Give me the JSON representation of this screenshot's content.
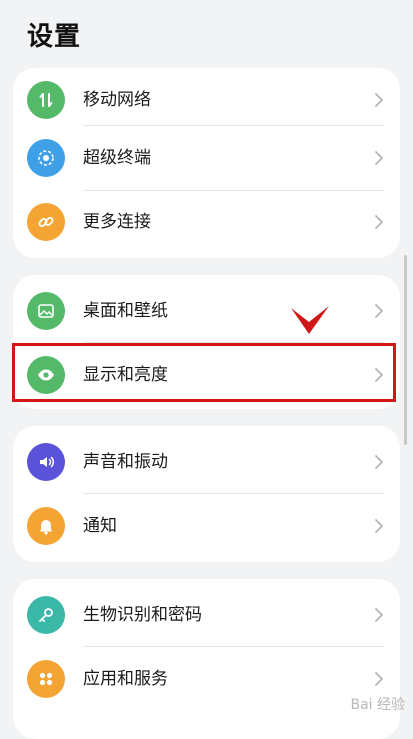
{
  "header": {
    "title": "设置"
  },
  "groups": [
    {
      "items": [
        {
          "label": "移动网络",
          "icon": "mobile-network-icon",
          "color": "#55b96a"
        },
        {
          "label": "超级终端",
          "icon": "super-device-icon",
          "color": "#3fa0e8"
        },
        {
          "label": "更多连接",
          "icon": "link-icon",
          "color": "#f4a432"
        }
      ]
    },
    {
      "items": [
        {
          "label": "桌面和壁纸",
          "icon": "wallpaper-icon",
          "color": "#55b96a"
        },
        {
          "label": "显示和亮度",
          "icon": "eye-icon",
          "color": "#55b96a"
        }
      ]
    },
    {
      "items": [
        {
          "label": "声音和振动",
          "icon": "speaker-icon",
          "color": "#5a52d8"
        },
        {
          "label": "通知",
          "icon": "bell-icon",
          "color": "#f4a432"
        }
      ]
    },
    {
      "items": [
        {
          "label": "生物识别和密码",
          "icon": "key-icon",
          "color": "#3cb8a8"
        },
        {
          "label": "应用和服务",
          "icon": "apps-icon",
          "color": "#f4a432"
        }
      ]
    }
  ],
  "annotation": {
    "highlighted_item": "显示和亮度",
    "highlight_color": "#d01818"
  },
  "watermark": {
    "text": "Bai 经验"
  }
}
